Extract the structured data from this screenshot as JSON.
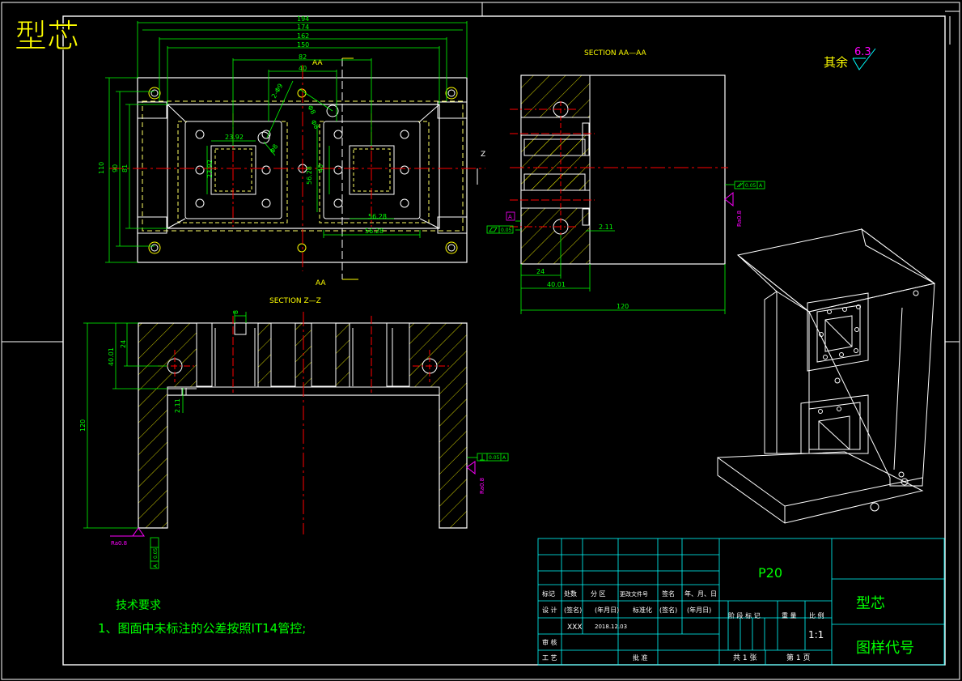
{
  "header": {
    "title": "型芯"
  },
  "roughness": {
    "label": "其余",
    "value": "6.3"
  },
  "front_view": {
    "dims_top": [
      "194",
      "174",
      "162",
      "150",
      "82",
      "40"
    ],
    "section_mark": "AA",
    "section_mark_bottom": "AA",
    "dims_left": [
      "110",
      "90",
      "81"
    ],
    "dims_inner": [
      "23.92",
      "23.92",
      "40",
      "56.28",
      "56.28",
      "56.28"
    ],
    "dims_diag": [
      "2-Φ9",
      "Φ8",
      "Φ8",
      "Φ8"
    ],
    "z_mark": "Z"
  },
  "section_aa": {
    "title": "SECTION AA—AA",
    "dims": [
      "24",
      "40.01",
      "120",
      "2.11"
    ],
    "tol_parallel": "0.05",
    "tol_datum": "A",
    "tol_flat": "0.05",
    "ra": "Ra0.8"
  },
  "section_zz": {
    "title": "SECTION Z—Z",
    "dims": [
      "120",
      "40.01",
      "24",
      "2.11",
      "8"
    ],
    "tol_perp": "0.05",
    "tol_datum": "A",
    "ra": "Ra0.8"
  },
  "tech": {
    "heading": "技术要求",
    "item1": "1、图面中未标注的公差按照IT14管控;"
  },
  "title_block": {
    "material": "P20",
    "part_name": "型芯",
    "drawing_no_label": "图样代号",
    "row_labels": [
      "标记",
      "处数",
      "分 区",
      "更改文件号",
      "签名",
      "年、月、日"
    ],
    "row2": [
      "设 计",
      "(签名)",
      "(年月日)",
      "标准化",
      "(签名)",
      "(年月日)"
    ],
    "designer": "XXX",
    "date": "2018.12.03",
    "review": "审 核",
    "craft": "工 艺",
    "approve": "批 准",
    "stage_labels": [
      "阶 段 标 记",
      "重 量",
      "比 例"
    ],
    "scale": "1:1",
    "sheets": "共 1 张",
    "sheet_no": "第 1 页"
  },
  "colors": {
    "background": "#000000",
    "frame": "#ffffff",
    "geometry": "#ffffff",
    "dimension": "#00ff00",
    "centerline": "#ff0000",
    "hatch": "#ffff00",
    "hidden": "#ffff66",
    "roughness": "#ff00ff",
    "title_block": "#00ffff",
    "title_text": "#ffff00"
  }
}
